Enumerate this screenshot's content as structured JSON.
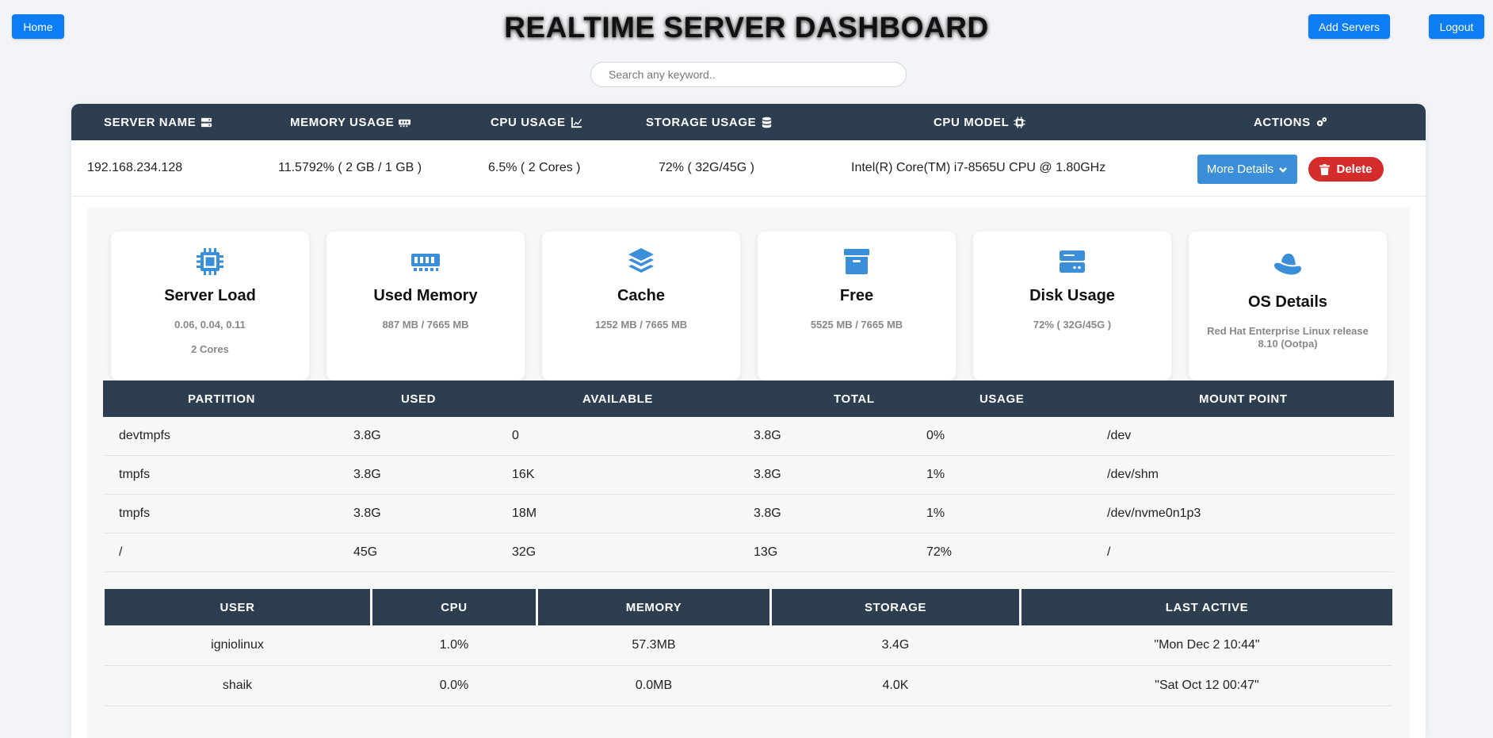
{
  "nav": {
    "home_label": "Home",
    "add_servers_label": "Add Servers",
    "logout_label": "Logout"
  },
  "page_title": "REALTIME SERVER DASHBOARD",
  "search": {
    "placeholder": "Search any keyword..",
    "value": ""
  },
  "accent_colors": {
    "header_bg": "#2d3e50",
    "primary": "#0d7df5",
    "info": "#3a8fd8",
    "danger": "#d42b2b"
  },
  "server_table": {
    "headers": {
      "server_name": "SERVER NAME",
      "memory_usage": "MEMORY USAGE",
      "cpu_usage": "CPU USAGE",
      "storage_usage": "STORAGE USAGE",
      "cpu_model": "CPU MODEL",
      "actions": "ACTIONS"
    },
    "header_icons": [
      "server-icon",
      "memory-icon",
      "chart-line-icon",
      "database-icon",
      "microchip-icon",
      "cogs-icon"
    ],
    "row": {
      "server_name": "192.168.234.128",
      "memory_usage": "11.5792% ( 2 GB / 1 GB )",
      "cpu_usage": "6.5% ( 2 Cores )",
      "storage_usage": "72% ( 32G/45G )",
      "cpu_model": "Intel(R) Core(TM) i7-8565U CPU @ 1.80GHz",
      "more_details_label": "More Details",
      "delete_label": "Delete"
    }
  },
  "cards": [
    {
      "icon": "microchip-icon",
      "title": "Server Load",
      "line1": "0.06, 0.04, 0.11",
      "line2": "2 Cores"
    },
    {
      "icon": "memory-icon",
      "title": "Used Memory",
      "line1": "887 MB / 7665 MB"
    },
    {
      "icon": "layer-group-icon",
      "title": "Cache",
      "line1": "1252 MB / 7665 MB"
    },
    {
      "icon": "archive-box-icon",
      "title": "Free",
      "line1": "5525 MB / 7665 MB"
    },
    {
      "icon": "hard-drive-icon",
      "title": "Disk Usage",
      "line1": "72% ( 32G/45G )"
    },
    {
      "icon": "redhat-icon",
      "title": "OS Details",
      "line1": "Red Hat Enterprise Linux release 8.10 (Ootpa)"
    }
  ],
  "partitions": {
    "headers": [
      "PARTITION",
      "USED",
      "AVAILABLE",
      "TOTAL",
      "USAGE",
      "MOUNT POINT"
    ],
    "rows": [
      [
        "devtmpfs",
        "3.8G",
        "0",
        "3.8G",
        "0%",
        "/dev"
      ],
      [
        "tmpfs",
        "3.8G",
        "16K",
        "3.8G",
        "1%",
        "/dev/shm"
      ],
      [
        "tmpfs",
        "3.8G",
        "18M",
        "3.8G",
        "1%",
        "/dev/nvme0n1p3"
      ],
      [
        "/",
        "45G",
        "32G",
        "13G",
        "72%",
        "/"
      ]
    ]
  },
  "users": {
    "headers": [
      "USER",
      "CPU",
      "MEMORY",
      "STORAGE",
      "LAST ACTIVE"
    ],
    "rows": [
      [
        "igniolinux",
        "1.0%",
        "57.3MB",
        "3.4G",
        "\"Mon Dec 2 10:44\""
      ],
      [
        "shaik",
        "0.0%",
        "0.0MB",
        "4.0K",
        "\"Sat Oct 12 00:47\""
      ]
    ]
  }
}
